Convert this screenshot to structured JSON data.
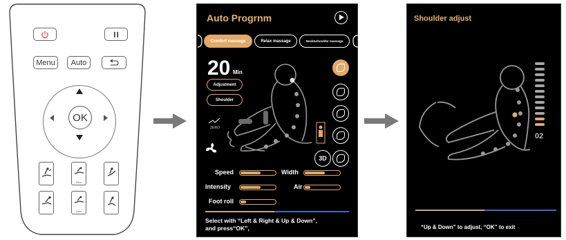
{
  "remote": {
    "menu_label": "Menu",
    "auto_label": "Auto",
    "ok_label": "OK",
    "zero_label": "Zero",
    "icons": [
      "power-icon",
      "pause-icon",
      "back-icon",
      "up-arrow-icon",
      "down-arrow-icon",
      "left-arrow-icon",
      "right-arrow-icon"
    ]
  },
  "screen1": {
    "title": "Auto Progrnm",
    "tabs": [
      {
        "label": "Comfort massage",
        "active": true
      },
      {
        "label": "Relax massage",
        "active": false
      },
      {
        "label": "Neck&shoulder massage",
        "active": false
      }
    ],
    "time_value": "20",
    "time_unit": "Min",
    "adjustment_label": "Adjustment",
    "shoulder_label": "Shoulder",
    "zero_label": "ZERO",
    "three_d_label": "3D",
    "controls": {
      "speed_label": "Speed",
      "width_label": "Width",
      "intensity_label": "Intensity",
      "air_label": "Air",
      "foot_roll_label": "Foot roll"
    },
    "levels": {
      "speed": 0.55,
      "width": 0.55,
      "intensity": 0.55,
      "air": 0.15,
      "foot_roll": 0.15
    },
    "hint_line1": "Select with “Left & Right & Up & Down”,",
    "hint_line2": "and press“OK”,"
  },
  "screen2": {
    "title": "Shoulder adjust",
    "level_value": "02",
    "hint": "“Up & Down” to adjust, “OK” to exit"
  },
  "colors": {
    "accent": "#e2a969",
    "title_gold": "#e8b36e",
    "screen_bg": "#000000",
    "progress_blue": "#3f6bd0",
    "progress_tan": "#c9a58a",
    "arrow_gray": "#7a7a7a"
  }
}
